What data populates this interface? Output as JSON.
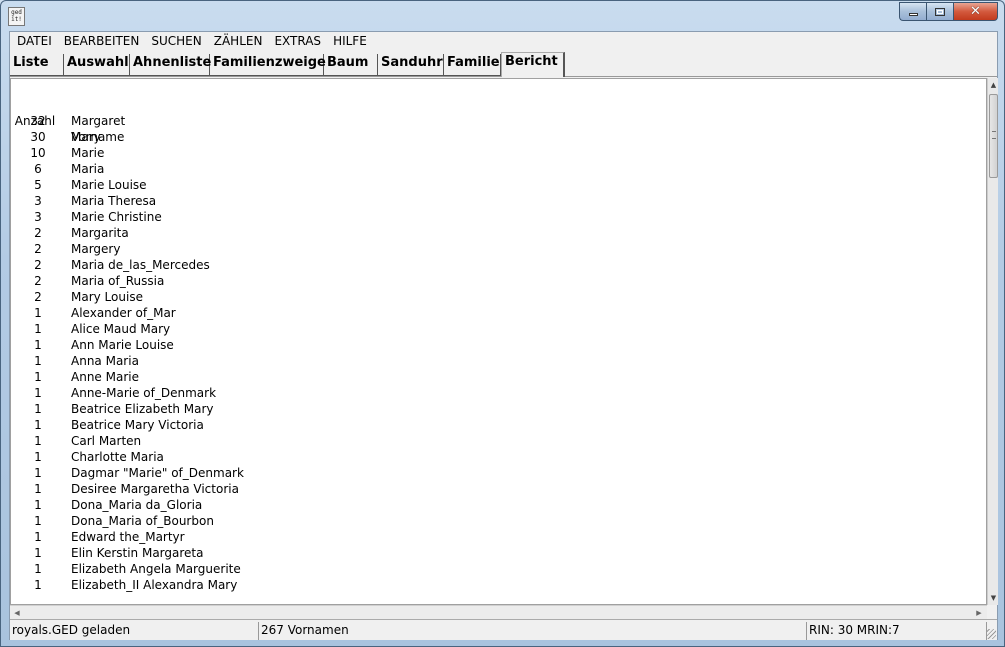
{
  "window": {
    "app_icon_text": "ged it!",
    "min_glyph": "",
    "close_glyph": "✕"
  },
  "menu": [
    "DATEI",
    "BEARBEITEN",
    "SUCHEN",
    "ZÄHLEN",
    "EXTRAS",
    "HILFE"
  ],
  "tabs": [
    {
      "label": "Liste"
    },
    {
      "label": "Auswahl"
    },
    {
      "label": "Ahnenliste"
    },
    {
      "label": "Familienzweige"
    },
    {
      "label": "Baum"
    },
    {
      "label": "Sanduhr"
    },
    {
      "label": "Familie"
    },
    {
      "label": "Bericht",
      "active": true
    }
  ],
  "report": {
    "header": {
      "count": "Anzahl",
      "name": "Vorname"
    },
    "rows": [
      {
        "count": "32",
        "name": "Margaret"
      },
      {
        "count": "30",
        "name": "Mary"
      },
      {
        "count": "10",
        "name": "Marie"
      },
      {
        "count": "6",
        "name": "Maria"
      },
      {
        "count": "5",
        "name": "Marie Louise"
      },
      {
        "count": "3",
        "name": "Maria Theresa"
      },
      {
        "count": "3",
        "name": "Marie Christine"
      },
      {
        "count": "2",
        "name": "Margarita"
      },
      {
        "count": "2",
        "name": "Margery"
      },
      {
        "count": "2",
        "name": "Maria de_las_Mercedes"
      },
      {
        "count": "2",
        "name": "Maria of_Russia"
      },
      {
        "count": "2",
        "name": "Mary Louise"
      },
      {
        "count": "1",
        "name": "Alexander of_Mar"
      },
      {
        "count": "1",
        "name": "Alice Maud Mary"
      },
      {
        "count": "1",
        "name": "Ann Marie Louise"
      },
      {
        "count": "1",
        "name": "Anna Maria"
      },
      {
        "count": "1",
        "name": "Anne Marie"
      },
      {
        "count": "1",
        "name": "Anne-Marie of_Denmark"
      },
      {
        "count": "1",
        "name": "Beatrice Elizabeth Mary"
      },
      {
        "count": "1",
        "name": "Beatrice Mary Victoria"
      },
      {
        "count": "1",
        "name": "Carl Marten"
      },
      {
        "count": "1",
        "name": "Charlotte Maria"
      },
      {
        "count": "1",
        "name": "Dagmar \"Marie\" of_Denmark"
      },
      {
        "count": "1",
        "name": "Desiree Margaretha Victoria"
      },
      {
        "count": "1",
        "name": "Dona_Maria da_Gloria"
      },
      {
        "count": "1",
        "name": "Dona_Maria of_Bourbon"
      },
      {
        "count": "1",
        "name": "Edward the_Martyr"
      },
      {
        "count": "1",
        "name": "Elin Kerstin Margareta"
      },
      {
        "count": "1",
        "name": "Elizabeth Angela Marguerite"
      },
      {
        "count": "1",
        "name": "Elizabeth_II Alexandra Mary"
      }
    ]
  },
  "scroll": {
    "up": "▲",
    "down": "▼",
    "left": "◀",
    "right": "▶"
  },
  "status": {
    "file": "royals.GED geladen",
    "count": "267 Vornamen",
    "ids": "RIN: 30  MRIN:7"
  }
}
